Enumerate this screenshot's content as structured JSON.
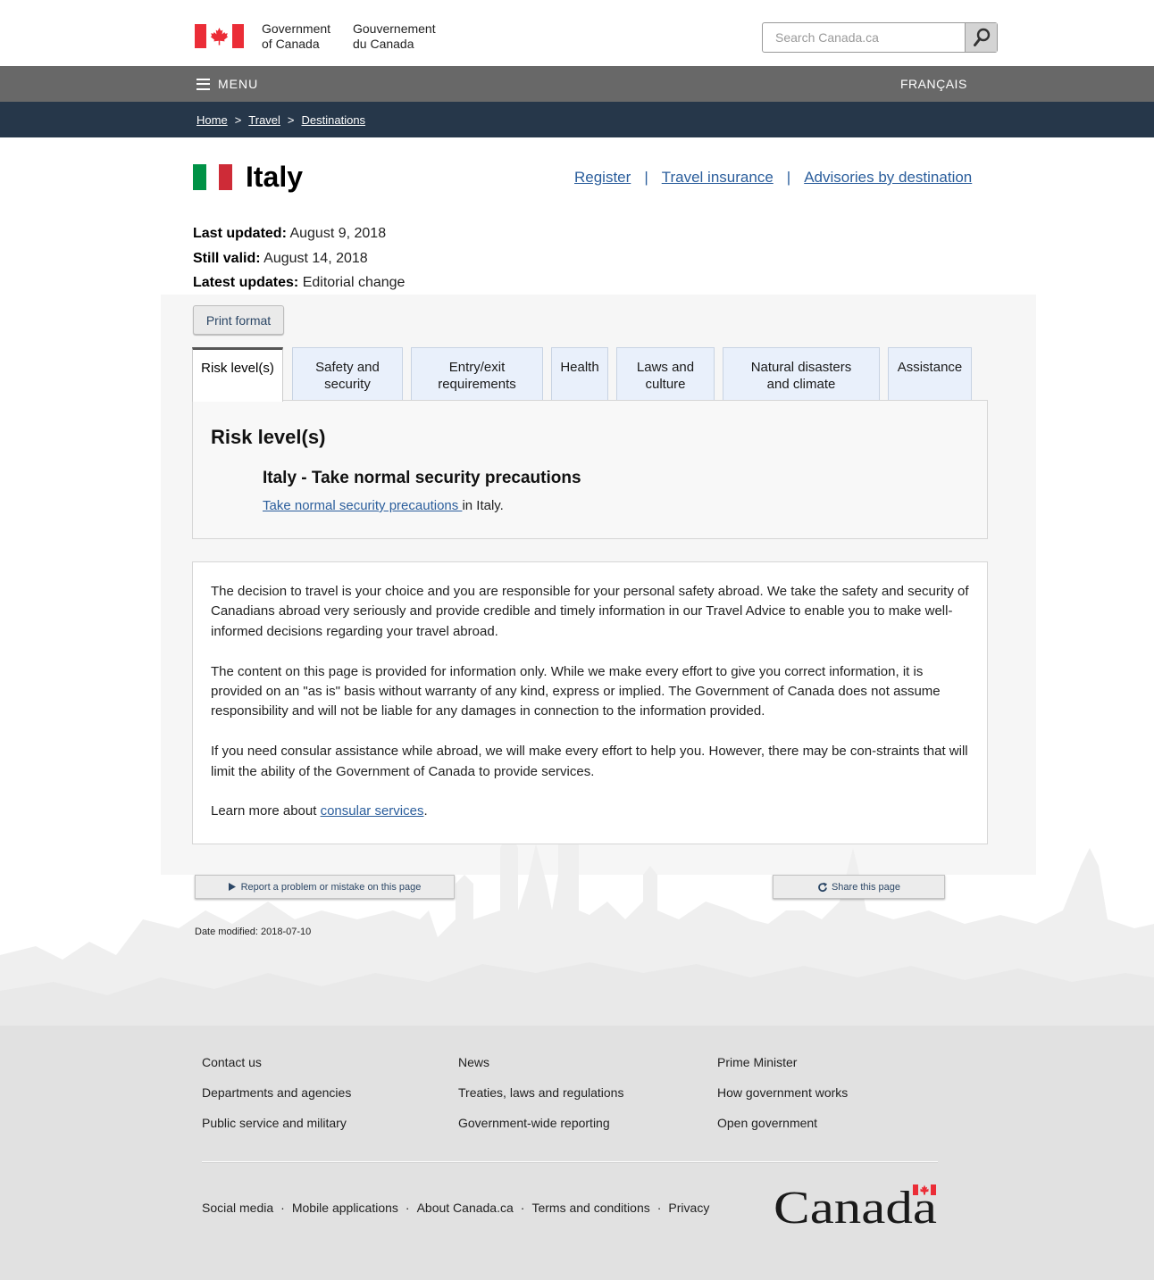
{
  "header": {
    "signature_en": [
      "Government",
      "of Canada"
    ],
    "signature_fr": [
      "Gouvernement",
      "du Canada"
    ],
    "search_placeholder": "Search Canada.ca",
    "search_icon": "search-icon",
    "flag_icon": "canada-flag-icon"
  },
  "menu_bar": {
    "menu_label": "MENU",
    "menu_icon": "hamburger-icon",
    "language_link": "FRANÇAIS"
  },
  "breadcrumb": {
    "items": [
      "Home",
      "Travel",
      "Destinations"
    ],
    "separator": ">"
  },
  "page": {
    "title": "Italy",
    "flag_icon": "italy-flag-icon",
    "title_links": [
      "Register",
      "Travel insurance",
      "Advisories by destination"
    ],
    "title_link_separator": "|",
    "meta": {
      "last_updated_label": "Last updated:",
      "last_updated_value": "August 9, 2018",
      "still_valid_label": "Still valid:",
      "still_valid_value": "August 14, 2018",
      "latest_updates_label": "Latest updates:",
      "latest_updates_value": "Editorial change"
    },
    "print_button": "Print format"
  },
  "tabs": [
    {
      "label_lines": [
        "Risk level(s)"
      ],
      "active": true
    },
    {
      "label_lines": [
        "Safety and",
        "security"
      ],
      "active": false
    },
    {
      "label_lines": [
        "Entry/exit",
        "requirements"
      ],
      "active": false
    },
    {
      "label_lines": [
        "Health"
      ],
      "active": false
    },
    {
      "label_lines": [
        "Laws and",
        "culture"
      ],
      "active": false
    },
    {
      "label_lines": [
        "Natural disasters",
        "and climate"
      ],
      "active": false
    },
    {
      "label_lines": [
        "Assistance"
      ],
      "active": false
    }
  ],
  "risk_panel": {
    "heading": "Risk level(s)",
    "risk_title": "Italy - Take normal security precautions",
    "risk_link": "Take normal security precautions ",
    "risk_suffix": "in Italy."
  },
  "disclaimer": {
    "p1": "The decision to travel is your choice and you are responsible for your personal safety abroad. We take the safety and security of Canadians abroad very seriously and provide credible and timely information in our Travel Advice to enable you to make well-informed decisions regarding your travel abroad.",
    "p2": "The content on this page is provided for information only. While we make every effort to give you correct information, it is provided on an \"as is\" basis without warranty of any kind, express or implied. The Government of Canada does not assume responsibility and will not be liable for any damages in connection to the information provided.",
    "p3": "If you need consular assistance while abroad, we will make every effort to help you. However, there may be con-straints that will limit the ability of the Government of Canada to provide services.",
    "p4_prefix": "Learn more about ",
    "p4_link": "consular services",
    "p4_suffix": "."
  },
  "page_details": {
    "report_button": "Report a problem or mistake on this page",
    "report_icon": "triangle-right-icon",
    "share_button": "Share this page",
    "share_icon": "share-icon",
    "date_modified_label": "Date modified:",
    "date_modified_value": "2018-07-10"
  },
  "footer": {
    "columns": [
      [
        "Contact us",
        "Departments and agencies",
        "Public service and military"
      ],
      [
        "News",
        "Treaties, laws and regulations",
        "Government-wide reporting"
      ],
      [
        "Prime Minister",
        "How government works",
        "Open government"
      ]
    ],
    "bottom_links": [
      "Social media",
      "Mobile applications",
      "About Canada.ca",
      "Terms and conditions",
      "Privacy"
    ],
    "separator": "·",
    "wordmark": "Canada"
  },
  "colors": {
    "menu_bar": "#686868",
    "breadcrumb_bar": "#26374a",
    "link": "#2b5e9c",
    "canada_red": "#eb2d37",
    "italy_green": "#009246",
    "italy_red": "#ce2b37",
    "tab_inactive": "#e9f0fb",
    "footer_bg": "#e1e1e1"
  }
}
